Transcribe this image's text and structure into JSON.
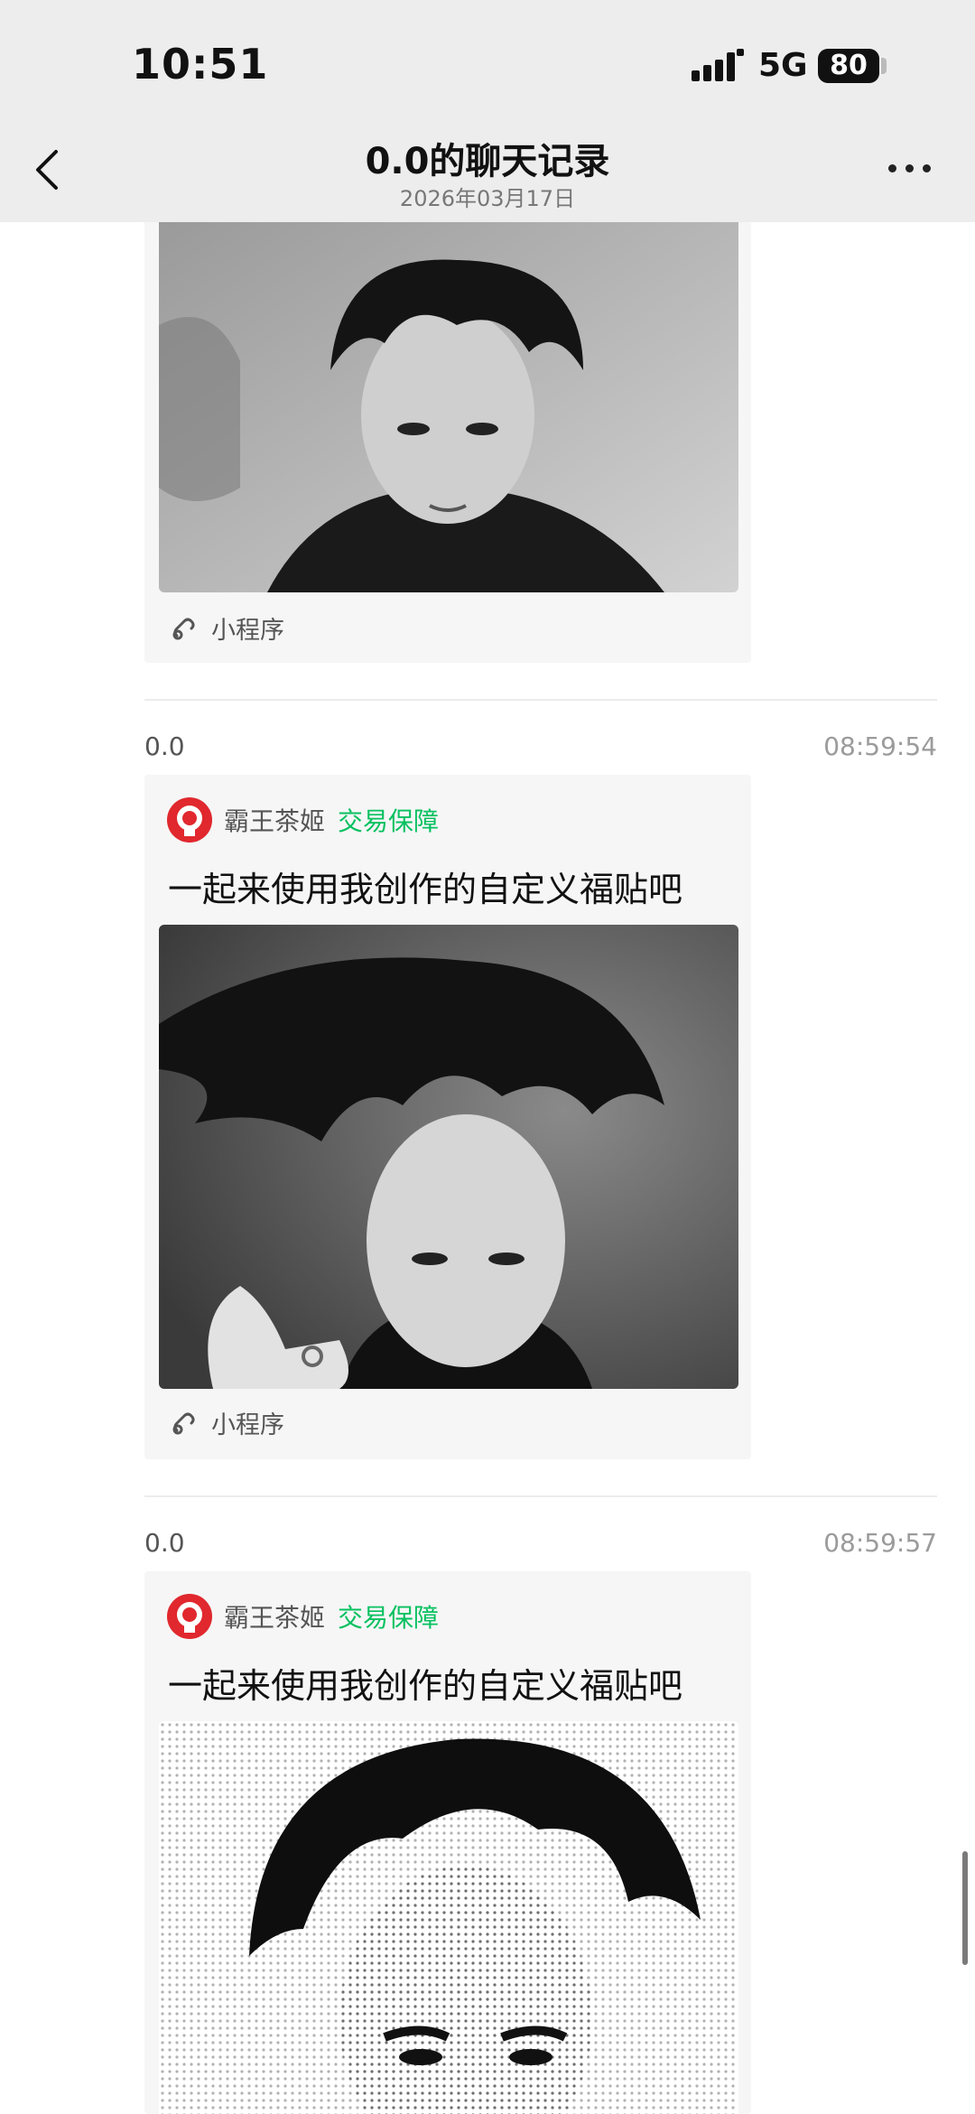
{
  "status_bar": {
    "time": "10:51",
    "network": "5G",
    "battery": "80"
  },
  "nav": {
    "title": "0.0的聊天记录",
    "date": "2026年03月17日"
  },
  "messages": [
    {
      "mini_program_label": "小程序"
    },
    {
      "sender": "0.0",
      "time": "08:59:54",
      "shop_name": "霸王茶姬",
      "shop_badge": "交易保障",
      "text": "一起来使用我创作的自定义福贴吧",
      "mini_program_label": "小程序"
    },
    {
      "sender": "0.0",
      "time": "08:59:57",
      "shop_name": "霸王茶姬",
      "shop_badge": "交易保障",
      "text": "一起来使用我创作的自定义福贴吧"
    }
  ],
  "colors": {
    "accent": "#07c160",
    "brand_red": "#e0282e",
    "header_bg": "#ededed"
  }
}
